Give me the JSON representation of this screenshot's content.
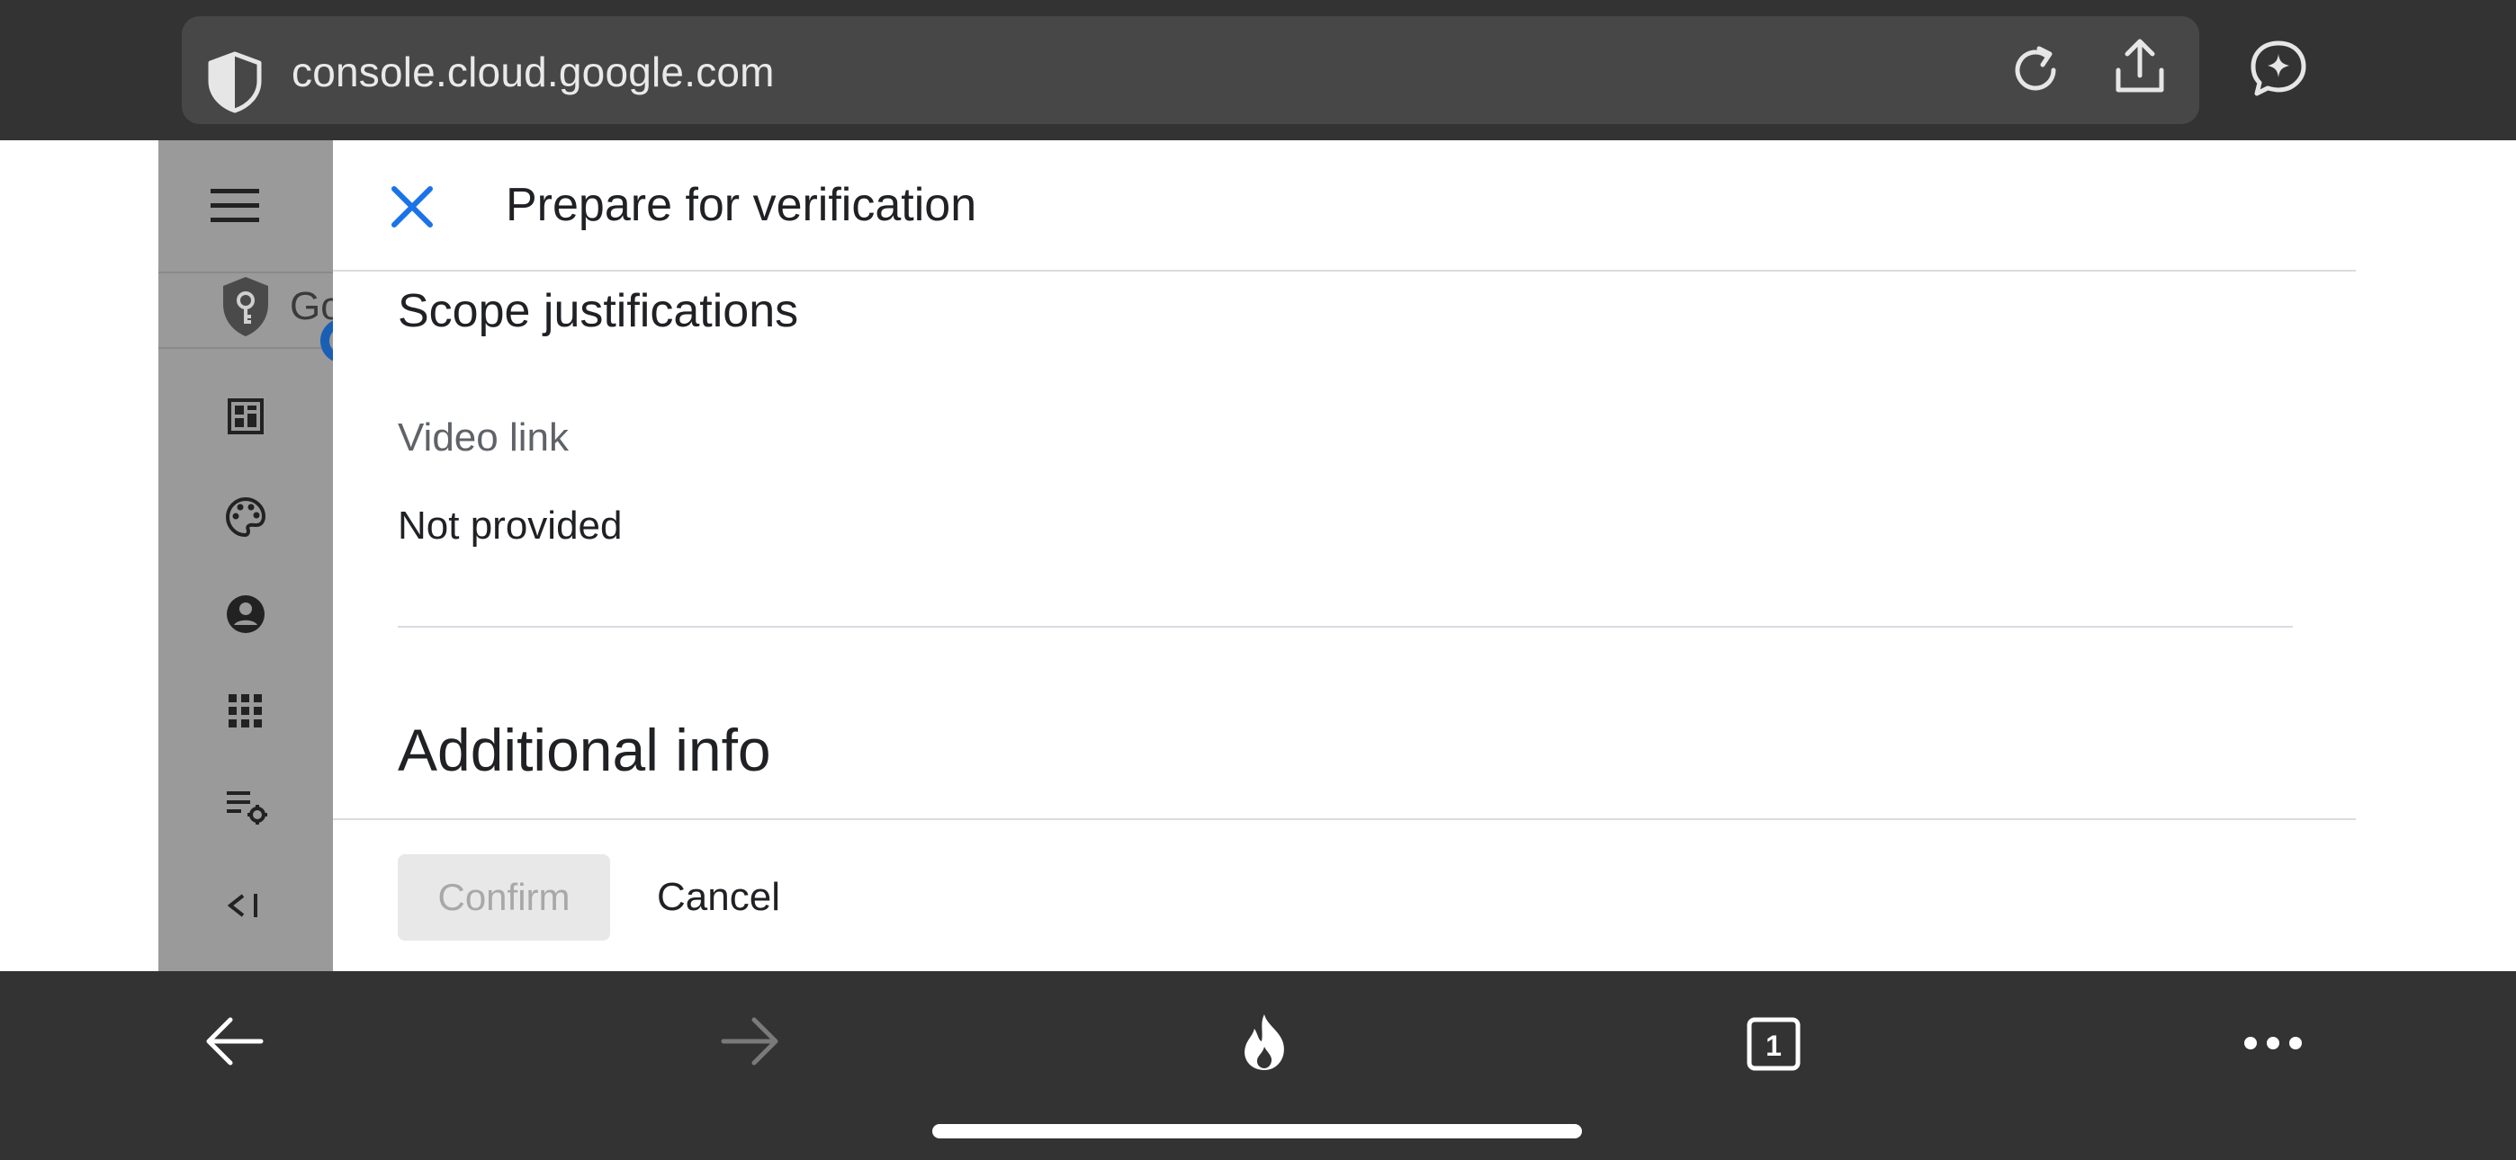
{
  "browser": {
    "url": "console.cloud.google.com"
  },
  "console": {
    "product_name_visible": "Go"
  },
  "dialog": {
    "title": "Prepare for verification",
    "section_title": "Scope justifications",
    "video_link_label": "Video link",
    "video_link_value": "Not provided",
    "additional_title": "Additional info",
    "confirm_label": "Confirm",
    "cancel_label": "Cancel",
    "confirm_enabled": false,
    "accent_color": "#1a73e8"
  },
  "toolbar": {
    "tab_count": "1"
  },
  "icons": {
    "top": [
      "shield-icon",
      "reload-icon",
      "share-icon",
      "assistant-sparkle-icon"
    ],
    "rail": [
      "menu-icon",
      "key-shield-icon",
      "dashboard-icon",
      "palette-icon",
      "account-circle-icon",
      "apps-grid-icon",
      "list-settings-icon",
      "collapse-rail-icon"
    ],
    "bottom": [
      "back-arrow-icon",
      "forward-arrow-icon",
      "fire-icon",
      "tabs-icon",
      "more-icon"
    ]
  }
}
